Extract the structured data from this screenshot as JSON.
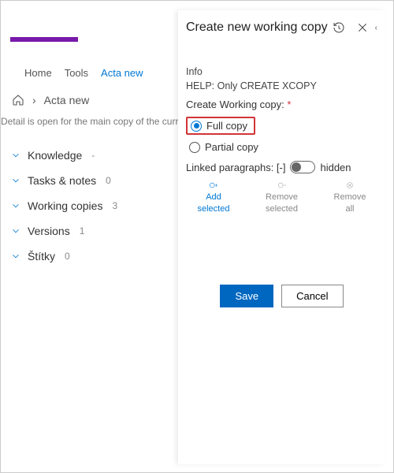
{
  "tabs": {
    "home": "Home",
    "tools": "Tools",
    "acta": "Acta new"
  },
  "breadcrumb": {
    "sep": "›",
    "current": "Acta new"
  },
  "detailNote": "Detail is open for the main copy of the curren",
  "sections": [
    {
      "label": "Knowledge",
      "count": "-"
    },
    {
      "label": "Tasks & notes",
      "count": "0"
    },
    {
      "label": "Working copies",
      "count": "3"
    },
    {
      "label": "Versions",
      "count": "1"
    },
    {
      "label": "Štítky",
      "count": "0"
    }
  ],
  "panel": {
    "title": "Create new working copy",
    "infoHead": "Info",
    "help": "HELP: Only CREATE XCOPY",
    "formLabel": "Create Working copy:",
    "req": "*",
    "optFull": "Full copy",
    "optPartial": "Partial copy",
    "linkedLabel": "Linked paragraphs: [-]",
    "hidden": "hidden",
    "actAdd1": "Add",
    "actAdd2": "selected",
    "actRem1": "Remove",
    "actRem2": "selected",
    "actAll1": "Remove",
    "actAll2": "all",
    "save": "Save",
    "cancel": "Cancel"
  }
}
